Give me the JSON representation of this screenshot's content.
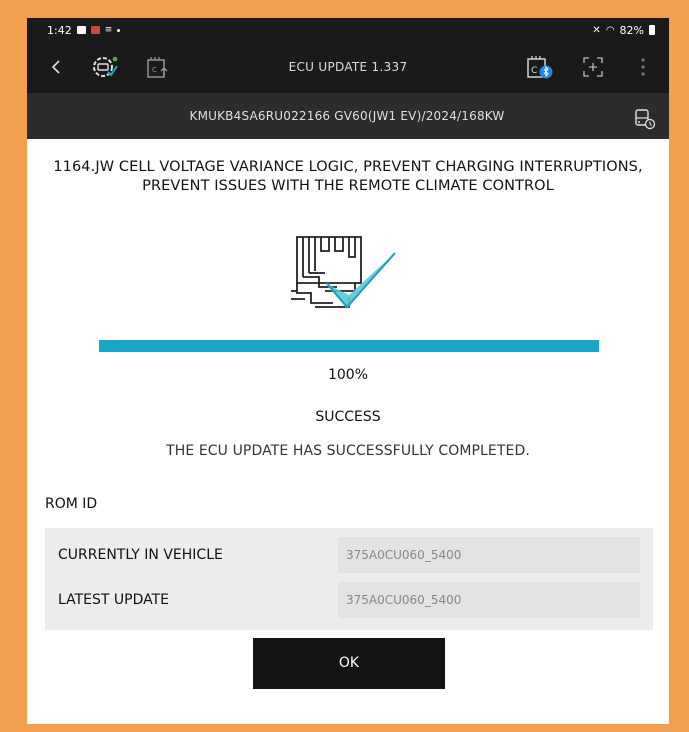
{
  "status_bar": {
    "time": "1:42",
    "battery": "82%"
  },
  "toolbar": {
    "title": "ECU UPDATE 1.337"
  },
  "vehicle": {
    "info": "KMUKB4SA6RU022166  GV60(JW1 EV)/2024/168KW"
  },
  "update": {
    "title_line1": "1164.JW CELL VOLTAGE VARIANCE LOGIC, PREVENT CHARGING INTERRUPTIONS,",
    "title_line2": "PREVENT ISSUES WITH THE REMOTE CLIMATE CONTROL",
    "progress_percent": 100,
    "progress_text": "100%",
    "status": "SUCCESS",
    "message": "THE ECU UPDATE HAS SUCCESSFULLY COMPLETED."
  },
  "rom": {
    "heading": "ROM ID",
    "rows": [
      {
        "label": "CURRENTLY IN VEHICLE",
        "value": "375A0CU060_5400"
      },
      {
        "label": "LATEST UPDATE",
        "value": "375A0CU060_5400"
      }
    ]
  },
  "ok_label": "OK",
  "colors": {
    "accent": "#19a6c9",
    "frame": "#f3a04e",
    "bar": "#1a1a1a"
  },
  "icons": [
    "back-icon",
    "vehicle-gear-icon",
    "ecu-upload-icon",
    "vci-bluetooth-icon",
    "scan-icon",
    "more-icon",
    "vehicle-settings-icon"
  ]
}
